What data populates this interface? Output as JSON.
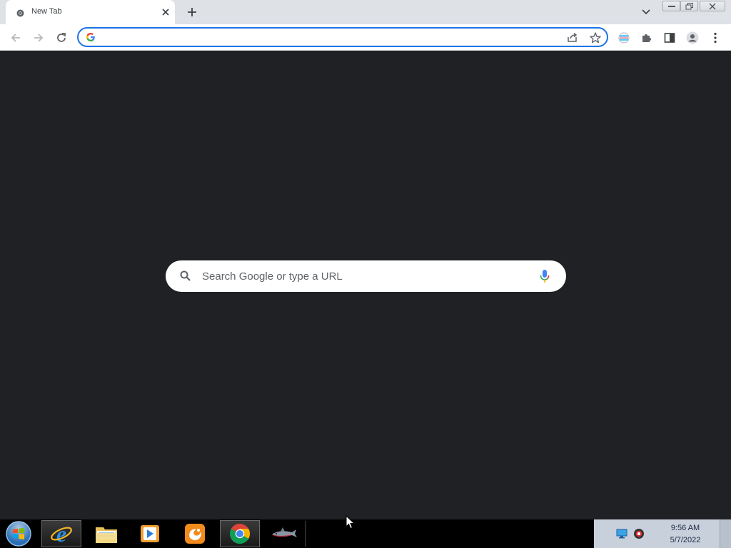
{
  "browser": {
    "tab": {
      "title": "New Tab"
    },
    "omnibox": {
      "value": "",
      "placeholder": ""
    }
  },
  "new_tab_page": {
    "search_placeholder": "Search Google or type a URL"
  },
  "taskbar": {
    "apps": [
      "internet-explorer",
      "file-explorer",
      "media-player",
      "uc-browser",
      "chrome",
      "game"
    ],
    "clock": {
      "time": "9:56 AM",
      "date": "5/7/2022"
    }
  },
  "colors": {
    "page_background": "#202124",
    "omnibox_focus": "#1a73e8",
    "tab_strip": "#dee1e6"
  }
}
